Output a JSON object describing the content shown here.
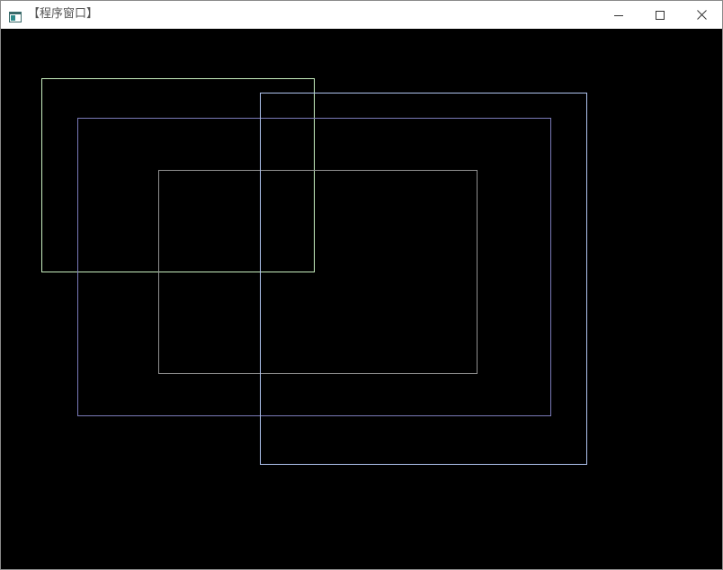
{
  "window": {
    "title": "【程序窗口】",
    "icon": "console-app-icon",
    "controls": {
      "minimize_icon": "minimize-icon",
      "maximize_icon": "maximize-icon",
      "close_icon": "close-icon"
    }
  },
  "canvas": {
    "background": "#000000",
    "rectangle_colors": {
      "rect_1": "#c8f0c0",
      "rect_2": "#7a7ab8",
      "rect_3": "#909090",
      "rect_4": "#b0c4f0"
    }
  }
}
